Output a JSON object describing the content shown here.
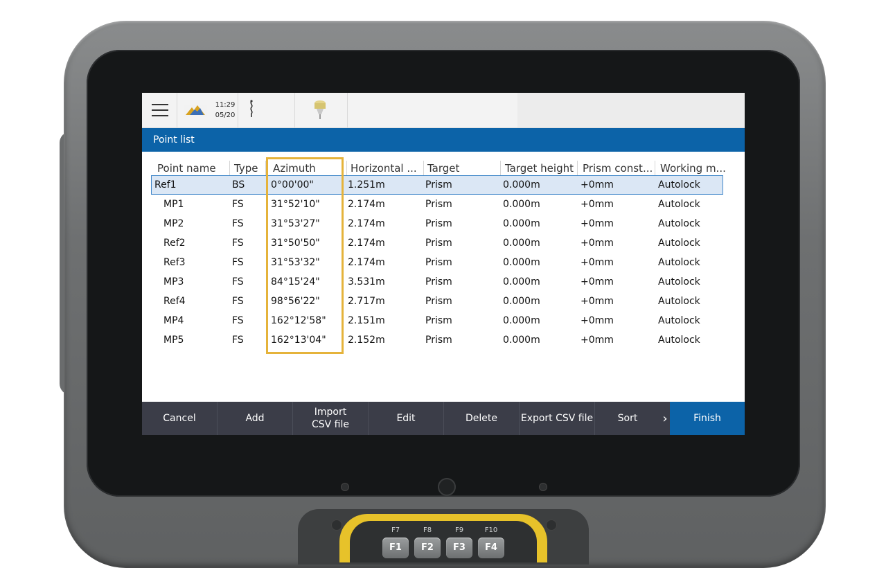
{
  "status": {
    "time": "11:29",
    "date": "05/20"
  },
  "title": "Point list",
  "columns": [
    "Point name",
    "Type",
    "Azimuth",
    "Horizontal ...",
    "Target",
    "Target height",
    "Prism const...",
    "Working m..."
  ],
  "rows": [
    {
      "name": "Ref1",
      "type": "BS",
      "azimuth": "0°00'00\"",
      "hdist": "1.251m",
      "target": "Prism",
      "height": "0.000m",
      "prism": "+0mm",
      "mode": "Autolock"
    },
    {
      "name": "MP1",
      "type": "FS",
      "azimuth": "31°52'10\"",
      "hdist": "2.174m",
      "target": "Prism",
      "height": "0.000m",
      "prism": "+0mm",
      "mode": "Autolock"
    },
    {
      "name": "MP2",
      "type": "FS",
      "azimuth": "31°53'27\"",
      "hdist": "2.174m",
      "target": "Prism",
      "height": "0.000m",
      "prism": "+0mm",
      "mode": "Autolock"
    },
    {
      "name": "Ref2",
      "type": "FS",
      "azimuth": "31°50'50\"",
      "hdist": "2.174m",
      "target": "Prism",
      "height": "0.000m",
      "prism": "+0mm",
      "mode": "Autolock"
    },
    {
      "name": "Ref3",
      "type": "FS",
      "azimuth": "31°53'32\"",
      "hdist": "2.174m",
      "target": "Prism",
      "height": "0.000m",
      "prism": "+0mm",
      "mode": "Autolock"
    },
    {
      "name": "MP3",
      "type": "FS",
      "azimuth": "84°15'24\"",
      "hdist": "3.531m",
      "target": "Prism",
      "height": "0.000m",
      "prism": "+0mm",
      "mode": "Autolock"
    },
    {
      "name": "Ref4",
      "type": "FS",
      "azimuth": "98°56'22\"",
      "hdist": "2.717m",
      "target": "Prism",
      "height": "0.000m",
      "prism": "+0mm",
      "mode": "Autolock"
    },
    {
      "name": "MP4",
      "type": "FS",
      "azimuth": "162°12'58\"",
      "hdist": "2.151m",
      "target": "Prism",
      "height": "0.000m",
      "prism": "+0mm",
      "mode": "Autolock"
    },
    {
      "name": "MP5",
      "type": "FS",
      "azimuth": "162°13'04\"",
      "hdist": "2.152m",
      "target": "Prism",
      "height": "0.000m",
      "prism": "+0mm",
      "mode": "Autolock"
    }
  ],
  "buttons": {
    "cancel": "Cancel",
    "add": "Add",
    "import": "Import CSV file",
    "edit": "Edit",
    "delete": "Delete",
    "export": "Export CSV file",
    "sort": "Sort",
    "more": "›",
    "finish": "Finish"
  },
  "keypad": {
    "upper": [
      "F7",
      "F8",
      "F9",
      "F10"
    ],
    "lower": [
      "F1",
      "F2",
      "F3",
      "F4"
    ]
  },
  "colors": {
    "accent": "#0c63a8",
    "highlight_box": "#e5b33b",
    "button_bar": "#3b3d48",
    "selected_row": "#dbe7f5"
  },
  "icons": [
    "menu-icon",
    "trimble-logo-icon",
    "antenna-icon",
    "gnss-receiver-icon",
    "chevron-right-icon"
  ]
}
